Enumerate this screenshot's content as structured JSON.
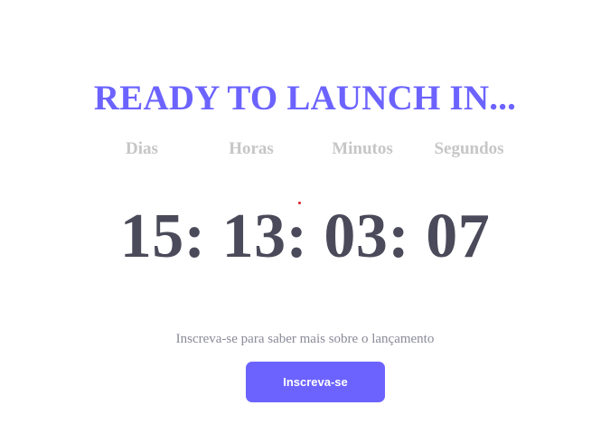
{
  "hero": {
    "title": "READY TO LAUNCH IN..."
  },
  "countdown": {
    "labels": [
      "Dias",
      "Horas",
      "Minutos",
      "Segundos"
    ],
    "days": "15",
    "hours": "13",
    "minutes": "03",
    "seconds": "07",
    "separator": ":"
  },
  "signup": {
    "text": "Inscreva-se para saber mais sobre o lançamento",
    "button_label": "Inscreva-se"
  },
  "colors": {
    "accent": "#6c63ff",
    "label_gray": "#c6c6c6",
    "digits": "#4a4a5a",
    "subtitle_gray": "#8a8a99",
    "button_text": "#ffffff",
    "dot": "#e01e2e"
  }
}
